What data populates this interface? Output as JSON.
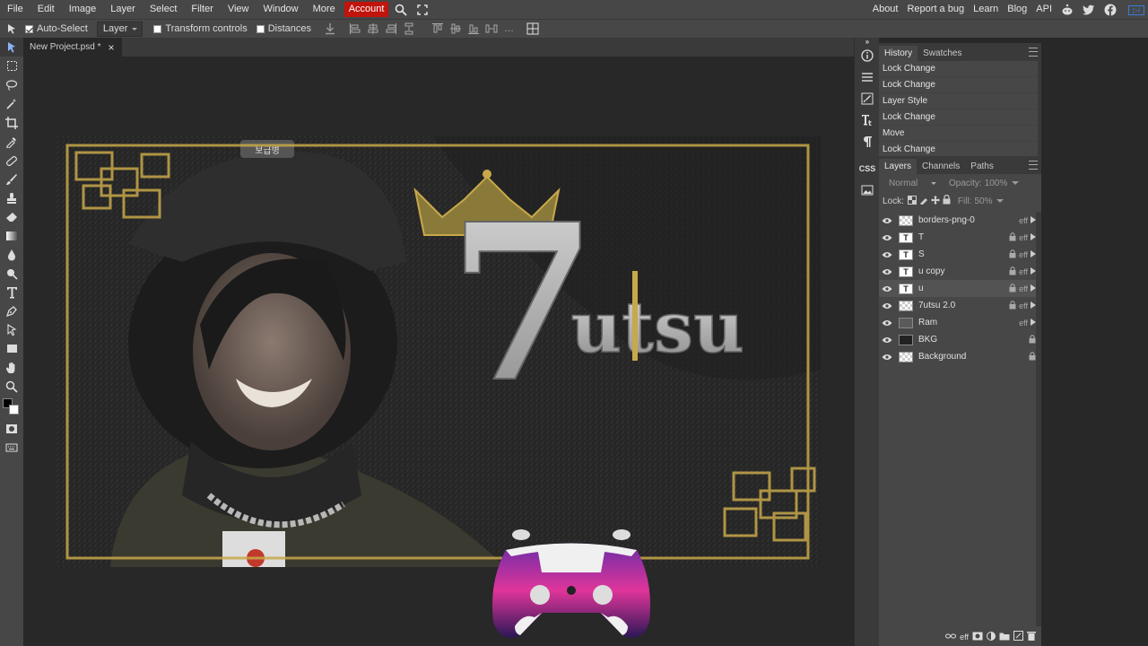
{
  "menubar": {
    "items": [
      "File",
      "Edit",
      "Image",
      "Layer",
      "Select",
      "Filter",
      "View",
      "Window",
      "More"
    ],
    "account": "Account",
    "right_links": [
      "About",
      "Report a bug",
      "Learn",
      "Blog",
      "API"
    ]
  },
  "options": {
    "auto_select_label": "Auto-Select",
    "auto_select_checked": true,
    "auto_select_target": "Layer",
    "transform_controls_label": "Transform controls",
    "distances_label": "Distances"
  },
  "document": {
    "tab_title": "New Project.psd *",
    "close_glyph": "×"
  },
  "artwork": {
    "logo_numeral": "7",
    "logo_script": "utsu",
    "helmet_patch": "보급병"
  },
  "history": {
    "tabs": [
      "History",
      "Swatches"
    ],
    "active_tab": "History",
    "items": [
      "Lock Change",
      "Lock Change",
      "Layer Style",
      "Lock Change",
      "Move",
      "Lock Change"
    ]
  },
  "layers_panel": {
    "tabs": [
      "Layers",
      "Channels",
      "Paths"
    ],
    "active_tab": "Layers",
    "blend_mode": "Normal",
    "opacity_label": "Opacity:",
    "opacity_value": "100%",
    "lock_label": "Lock:",
    "fill_label": "Fill:",
    "fill_value": "50%",
    "layers": [
      {
        "name": "borders-png-0",
        "thumb": "checker",
        "locked": false,
        "eff": true,
        "selected": false
      },
      {
        "name": "T",
        "thumb": "text",
        "locked": true,
        "eff": true,
        "selected": false
      },
      {
        "name": "S",
        "thumb": "text",
        "locked": true,
        "eff": true,
        "selected": false
      },
      {
        "name": "u copy",
        "thumb": "text",
        "locked": true,
        "eff": true,
        "selected": false
      },
      {
        "name": "u",
        "thumb": "text",
        "locked": true,
        "eff": true,
        "selected": true
      },
      {
        "name": "7utsu 2.0",
        "thumb": "checker",
        "locked": true,
        "eff": true,
        "selected": false
      },
      {
        "name": "Ram",
        "thumb": "image",
        "locked": false,
        "eff": true,
        "selected": false
      },
      {
        "name": "BKG",
        "thumb": "dark",
        "locked": true,
        "eff": false,
        "selected": false
      },
      {
        "name": "Background",
        "thumb": "checker",
        "locked": true,
        "eff": false,
        "selected": false
      }
    ],
    "eff_label": "eff",
    "text_thumb_glyph": "T"
  },
  "side_strip": {
    "css_label": "CSS"
  },
  "colors": {
    "accent_red": "#c0140c",
    "panel_bg": "#474747",
    "workspace_bg": "#282828",
    "gold": "#c8a84a"
  }
}
